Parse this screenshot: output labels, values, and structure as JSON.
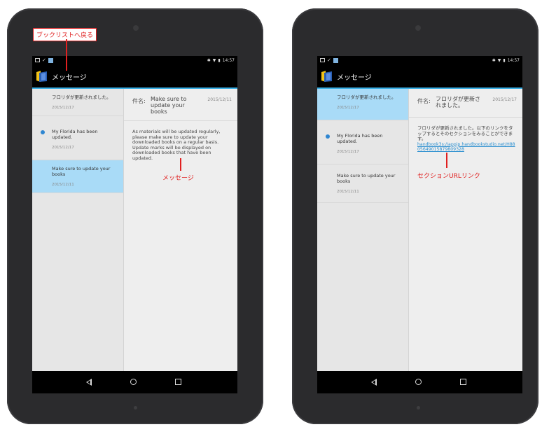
{
  "devices": [
    {
      "status_time": "14:57",
      "app_title": "メッセージ",
      "list": [
        {
          "title": "フロリダが更新されました。",
          "date": "2015/12/17",
          "unread": false,
          "selected": false
        },
        {
          "title": "My Florida has been updated.",
          "date": "2015/12/17",
          "unread": true,
          "selected": false
        },
        {
          "title": "Make sure to update your books",
          "date": "2015/12/11",
          "unread": false,
          "selected": true
        }
      ],
      "detail": {
        "subject_label": "件名:",
        "subject": "Make sure to update your books",
        "date": "2015/12/11",
        "body": "As materials will be updated regularly, please make sure to update your downloaded books on a regular basis. Update marks will be displayed on downloaded books that have been updated.",
        "link": ""
      }
    },
    {
      "status_time": "14:57",
      "app_title": "メッセージ",
      "list": [
        {
          "title": "フロリダが更新されました。",
          "date": "2015/12/17",
          "unread": false,
          "selected": true
        },
        {
          "title": "My Florida has been updated.",
          "date": "2015/12/17",
          "unread": true,
          "selected": false
        },
        {
          "title": "Make sure to update your books",
          "date": "2015/12/11",
          "unread": false,
          "selected": false
        }
      ],
      "detail": {
        "subject_label": "件名:",
        "subject": "フロリダが更新されました。",
        "date": "2015/12/17",
        "body": "フロリダが更新されました。以下のリンクをタップするとそのセクションをみることができます。",
        "link": "handbook3s://appjp.handbookstudio.net/H8805649015879809328"
      }
    }
  ],
  "annotations": {
    "back_to_booklist": "ブックリストへ戻る",
    "message": "メッセージ",
    "section_url_link": "セクションURLリンク"
  },
  "colors": {
    "accent": "#3bb0e6",
    "selected_row": "#a9dbf7",
    "unread_dot": "#2e86d1",
    "annotation": "#e02020",
    "link": "#2b8fd0"
  }
}
